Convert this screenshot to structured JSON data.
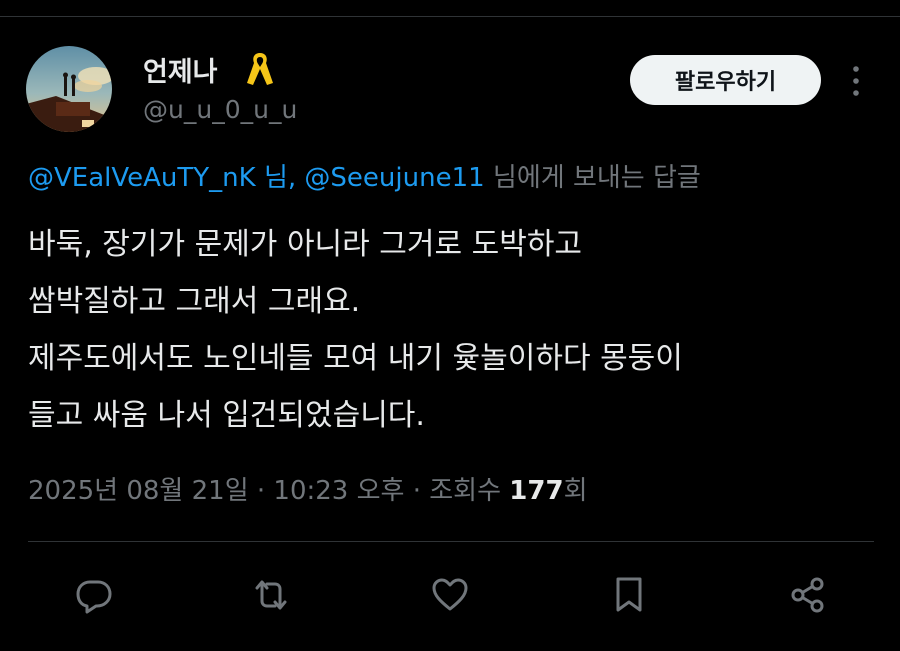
{
  "author": {
    "display_name": "언제나",
    "handle": "@u_u_0_u_u",
    "badge_icon": "yellow-ribbon-icon",
    "avatar_icon": "sunset-rooftop-avatar"
  },
  "follow_label": "팔로우하기",
  "reply_context": {
    "mention_1": "@VEalVeAuTY_nK",
    "separator": " 님, ",
    "mention_2": "@Seeujune11",
    "suffix": " 님에게 보내는 답글"
  },
  "tweet": {
    "lines": [
      "바둑, 장기가 문제가 아니라 그거로 도박하고",
      "쌈박질하고 그래서 그래요.",
      "제주도에서도 노인네들 모여 내기 윷놀이하다 몽둥이",
      "들고 싸움 나서 입건되었습니다."
    ]
  },
  "meta": {
    "timestamp": "2025년 08월 21일 · 10:23 오후 · 조회수 ",
    "view_count": "177",
    "view_suffix": "회"
  },
  "actions": [
    "reply-icon",
    "retweet-icon",
    "like-icon",
    "bookmark-icon",
    "share-icon"
  ],
  "colors": {
    "background": "#000000",
    "text": "#e7e9ea",
    "secondary": "#71767b",
    "link": "#1d9bf0",
    "divider": "#2f3336",
    "ribbon": "#f5c518"
  }
}
